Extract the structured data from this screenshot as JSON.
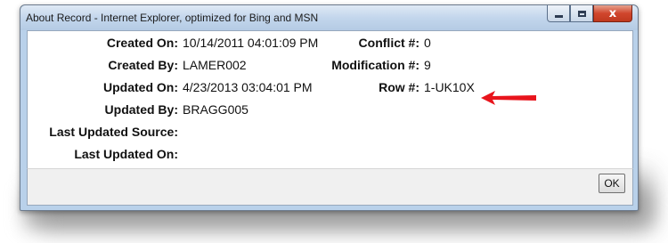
{
  "window": {
    "title": "About Record - Internet Explorer, optimized for Bing and MSN"
  },
  "caption_buttons": {
    "minimize_icon": "minimize-icon",
    "maximize_icon": "maximize-icon",
    "close_glyph": "x"
  },
  "details": {
    "created_on_label": "Created On:",
    "created_on_value": "10/14/2011 04:01:09 PM",
    "created_by_label": "Created By:",
    "created_by_value": "LAMER002",
    "updated_on_label": "Updated On:",
    "updated_on_value": "4/23/2013 03:04:01 PM",
    "updated_by_label": "Updated By:",
    "updated_by_value": "BRAGG005",
    "last_updated_source_label": "Last Updated Source:",
    "last_updated_source_value": "",
    "last_updated_on_label": "Last Updated On:",
    "last_updated_on_value": "",
    "conflict_label": "Conflict #:",
    "conflict_value": "0",
    "modification_label": "Modification #:",
    "modification_value": "9",
    "row_label": "Row #:",
    "row_value": "1-UK10X"
  },
  "footer": {
    "ok_label": "OK"
  },
  "annotation": {
    "arrow_icon": "red-arrow-icon",
    "arrow_color": "#e8141c"
  }
}
